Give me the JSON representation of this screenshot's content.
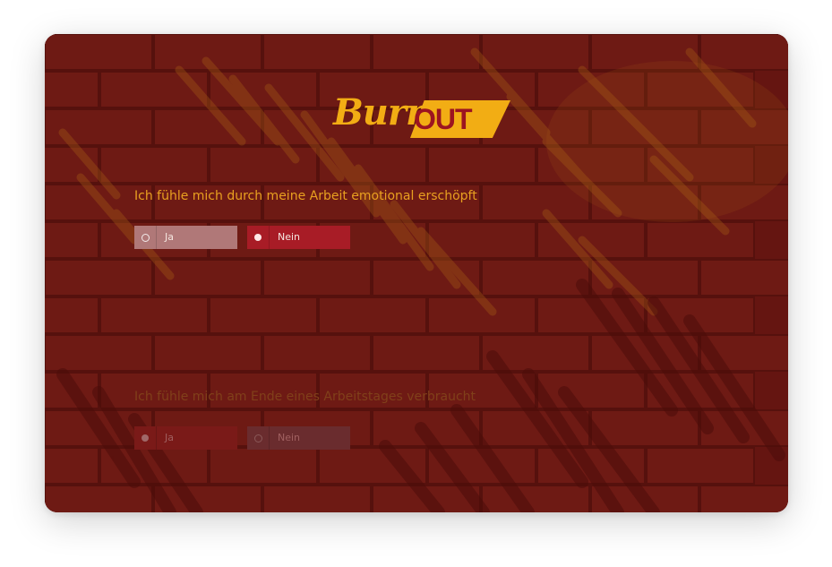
{
  "logo": {
    "burn": "Burn",
    "out": "OUT"
  },
  "questions": [
    {
      "text": "Ich fühle mich durch meine Arbeit emotional erschöpft",
      "options": [
        {
          "label": "Ja",
          "selected": false
        },
        {
          "label": "Nein",
          "selected": true
        }
      ]
    },
    {
      "text": "Ich fühle mich am Ende eines Arbeitstages verbraucht",
      "options": [
        {
          "label": "Ja",
          "selected": true
        },
        {
          "label": "Nein",
          "selected": false
        }
      ]
    }
  ],
  "colors": {
    "accent": "#f2ad14",
    "selected": "#a81c26",
    "background": "#5a1410"
  }
}
